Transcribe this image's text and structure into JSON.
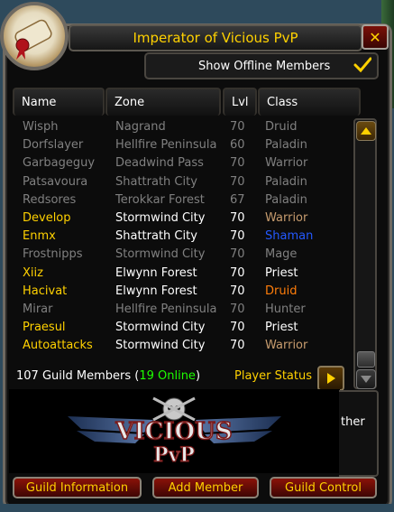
{
  "window": {
    "title": "Imperator of Vicious PvP",
    "close_label": "✕"
  },
  "show_offline": {
    "label": "Show Offline Members",
    "checked": true
  },
  "columns": {
    "name": "Name",
    "zone": "Zone",
    "lvl": "Lvl",
    "class": "Class"
  },
  "members": [
    {
      "name": "Wisph",
      "zone": "Nagrand",
      "lvl": "70",
      "class": "Druid",
      "online": false
    },
    {
      "name": "Dorfslayer",
      "zone": "Hellfire Peninsula",
      "lvl": "60",
      "class": "Paladin",
      "online": false
    },
    {
      "name": "Garbageguy",
      "zone": "Deadwind Pass",
      "lvl": "70",
      "class": "Warrior",
      "online": false
    },
    {
      "name": "Patsavoura",
      "zone": "Shattrath City",
      "lvl": "70",
      "class": "Paladin",
      "online": false
    },
    {
      "name": "Redsores",
      "zone": "Terokkar Forest",
      "lvl": "67",
      "class": "Paladin",
      "online": false
    },
    {
      "name": "Develop",
      "zone": "Stormwind City",
      "lvl": "70",
      "class": "Warrior",
      "online": true
    },
    {
      "name": "Enmx",
      "zone": "Shattrath City",
      "lvl": "70",
      "class": "Shaman",
      "online": true
    },
    {
      "name": "Frostnipps",
      "zone": "Stormwind City",
      "lvl": "70",
      "class": "Mage",
      "online": false
    },
    {
      "name": "Xiiz",
      "zone": "Elwynn Forest",
      "lvl": "70",
      "class": "Priest",
      "online": true
    },
    {
      "name": "Hacivat",
      "zone": "Elwynn Forest",
      "lvl": "70",
      "class": "Druid",
      "online": true
    },
    {
      "name": "Mirar",
      "zone": "Hellfire Peninsula",
      "lvl": "70",
      "class": "Hunter",
      "online": false
    },
    {
      "name": "Praesul",
      "zone": "Stormwind City",
      "lvl": "70",
      "class": "Priest",
      "online": true
    },
    {
      "name": "Autoattacks",
      "zone": "Stormwind City",
      "lvl": "70",
      "class": "Warrior",
      "online": true
    }
  ],
  "class_colors": {
    "Warrior": "#c79c6e",
    "Shaman": "#2459ff",
    "Druid": "#ff7d0a",
    "Priest": "#ffffff",
    "Paladin": "#f58cba",
    "Mage": "#69ccf0",
    "Hunter": "#abd473"
  },
  "colors": {
    "offline": "#808080",
    "online_name": "#ffd100",
    "online_text": "#ffffff",
    "online_status": "#1eff00"
  },
  "summary": {
    "count_text": "107 Guild Members (",
    "online_text": "19 Online",
    "close_paren": ")",
    "player_status_label": "Player Status"
  },
  "banner": {
    "line1": "VICIOUS",
    "line2": "PvP"
  },
  "side_panel": {
    "text": "ther"
  },
  "buttons": {
    "guild_information": "Guild Information",
    "add_member": "Add Member",
    "guild_control": "Guild Control"
  },
  "icons": {
    "portrait": "scroll-tabard-icon",
    "checkbox": "checkmark-icon",
    "scroll_up": "scroll-up-arrow-icon",
    "scroll_down": "scroll-down-arrow-icon",
    "player_status": "arrow-right-icon"
  }
}
